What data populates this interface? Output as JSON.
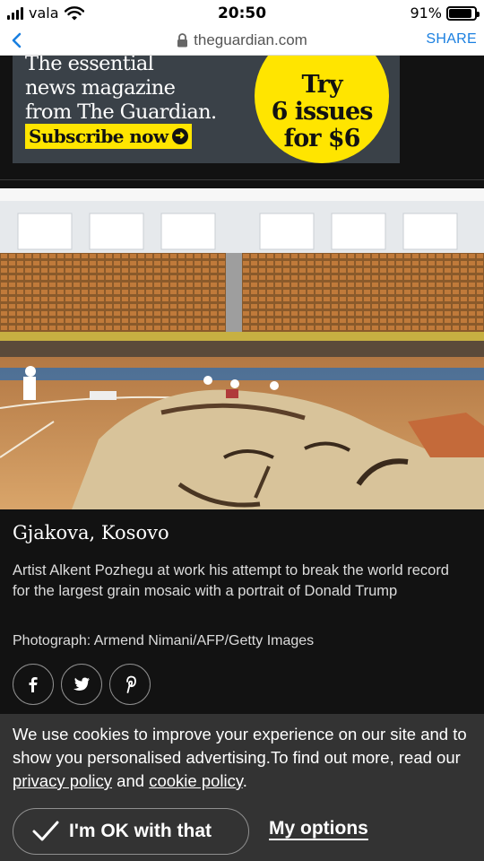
{
  "status_bar": {
    "carrier": "vala",
    "time": "20:50",
    "battery_percent": "91%",
    "battery_level": 0.91,
    "icons": [
      "signal-icon",
      "wifi-icon",
      "battery-icon"
    ]
  },
  "browser": {
    "url": "theguardian.com",
    "share_label": "SHARE",
    "icons": [
      "back-arrow-icon",
      "lock-icon"
    ],
    "accent_color": "#1a7fe0"
  },
  "ad": {
    "line1": "The essential",
    "line2": "news magazine",
    "line3": "from The Guardian.",
    "cta": "Subscribe now",
    "offer_line1": "Try",
    "offer_line2": "6 issues",
    "offer_line3": "for $6",
    "brand_yellow": "#ffe500",
    "icons": [
      "arrow-right-icon"
    ]
  },
  "photo": {
    "location": "Gjakova, Kosovo",
    "description": "Artist Alkent Pozhegu at work his attempt to break the world record for the largest grain mosaic with a portrait of Donald Trump",
    "credit": "Photograph: Armend Nimani/AFP/Getty Images"
  },
  "share": {
    "icons": [
      "facebook-icon",
      "twitter-icon",
      "pinterest-icon"
    ]
  },
  "cookie": {
    "text_before": "We use cookies to improve your experience on our site and to show you personalised advertising.To find out more, read our ",
    "privacy_link": "privacy policy",
    "text_and": " and ",
    "cookie_link": "cookie policy",
    "text_end": ".",
    "ok_label": "I'm OK with that",
    "options_label": "My options",
    "icons": [
      "checkmark-icon"
    ]
  }
}
